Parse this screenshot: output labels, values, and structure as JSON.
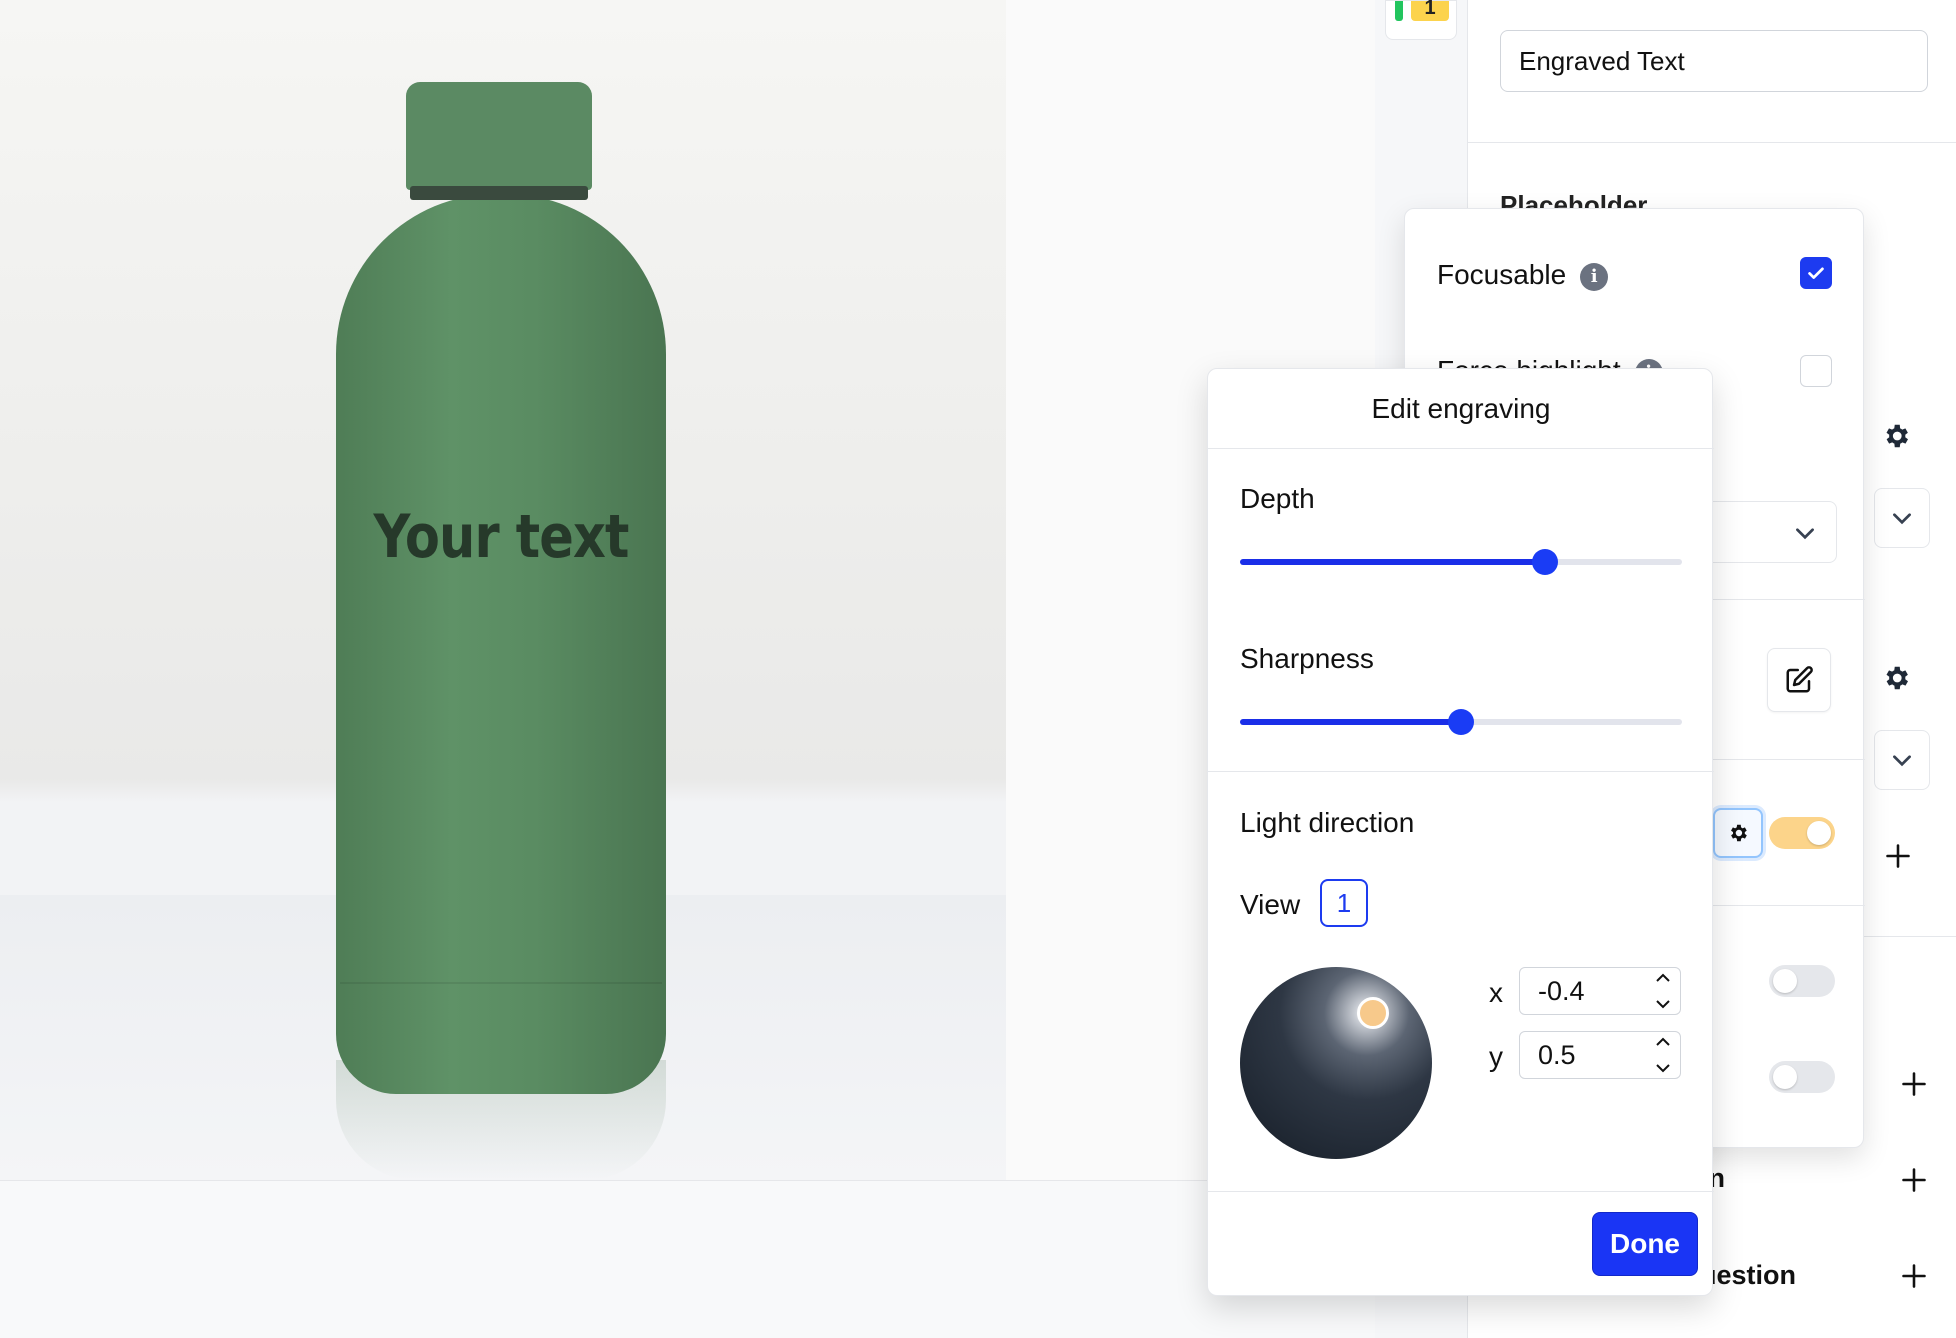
{
  "canvas": {
    "engraving_preview_text": "Your text"
  },
  "step_indicator": {
    "number": "1"
  },
  "sidebar": {
    "field_name_value": "Engraved Text",
    "placeholder_label": "Placeholder",
    "partial_label_1": "on",
    "partial_label_2": "uestion",
    "toggle_states": {
      "engraving_enabled": true,
      "toggle_2": false,
      "toggle_3": false
    }
  },
  "settings_popover": {
    "focusable_label": "Focusable",
    "focusable_checked": true,
    "force_highlight_label": "Force highlight",
    "force_highlight_checked": false
  },
  "engraving_popover": {
    "title": "Edit engraving",
    "depth_label": "Depth",
    "depth_value": 0.69,
    "sharpness_label": "Sharpness",
    "sharpness_value": 0.5,
    "light_direction_label": "Light direction",
    "view_label": "View",
    "view_value": "1",
    "x_label": "x",
    "x_value": "-0.4",
    "y_label": "y",
    "y_value": "0.5",
    "done_label": "Done"
  },
  "colors": {
    "accent": "#1a35f5",
    "toggle_on": "#fcd48a",
    "light_dot": "#f7c98b",
    "bottle": "#5b8a63"
  },
  "icons": [
    "info-icon",
    "checkmark-icon",
    "gear-icon",
    "chevron-down-icon",
    "edit-icon",
    "plus-icon",
    "chevron-up-icon"
  ]
}
